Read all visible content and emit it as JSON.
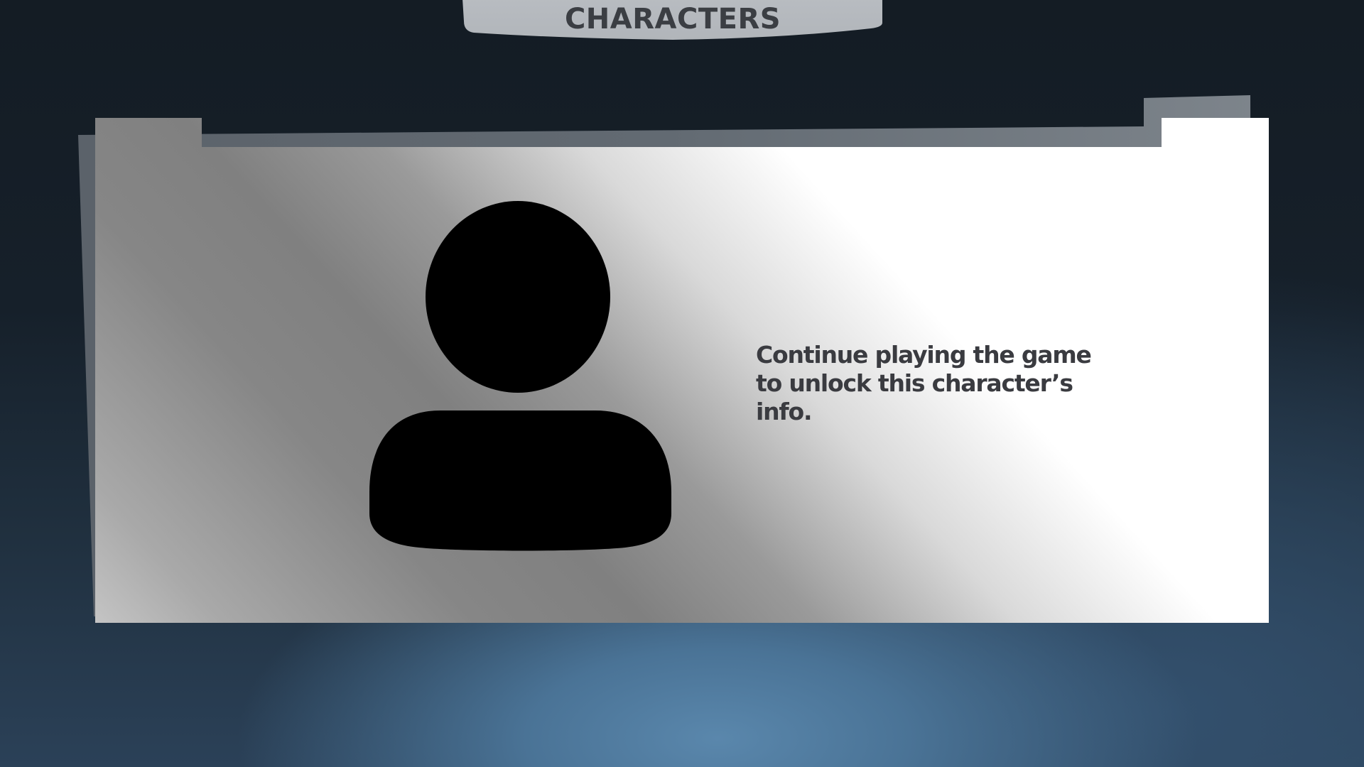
{
  "header": {
    "title": "CHARACTERS"
  },
  "character_panel": {
    "portrait_icon": "person-silhouette-icon",
    "locked_message": "Continue playing the game to unlock this character’s info."
  },
  "colors": {
    "header_tab": "#b5b9be",
    "title_text": "#3b3e43",
    "message_text": "#3a3b40",
    "background_dark": "#141c24",
    "background_glow": "#5a87ac",
    "card_light": "#ffffff",
    "card_shadow": "#808080"
  }
}
